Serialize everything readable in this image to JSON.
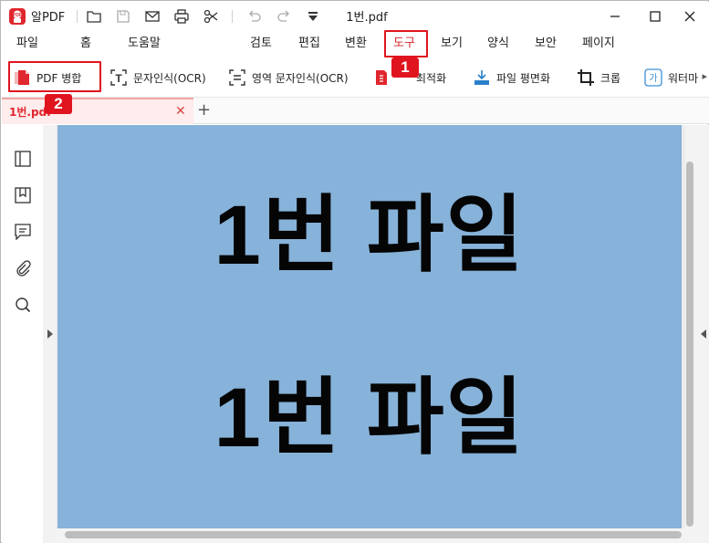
{
  "app": {
    "name": "알PDF",
    "document_title": "1번.pdf"
  },
  "titlebar": {
    "icons": [
      "folder-open-icon",
      "save-icon",
      "mail-icon",
      "print-icon",
      "scissors-icon",
      "undo-icon",
      "redo-icon",
      "quick-access-dropdown-icon"
    ],
    "window_controls": [
      "minimize-icon",
      "maximize-icon",
      "close-icon"
    ]
  },
  "menu": {
    "items": [
      "파일",
      "홈",
      "도움말",
      "검토",
      "편집",
      "변환",
      "도구",
      "보기",
      "양식",
      "보안",
      "페이지"
    ],
    "active": "도구"
  },
  "toolbar": {
    "tools": [
      {
        "label": "PDF 병합",
        "icon": "pdf-merge-icon"
      },
      {
        "label": "문자인식(OCR)",
        "icon": "text-ocr-icon"
      },
      {
        "label": "영역 문자인식(OCR)",
        "icon": "area-ocr-icon"
      },
      {
        "label": "최적화",
        "icon": "optimize-icon"
      },
      {
        "label": "파일 평면화",
        "icon": "flatten-icon"
      },
      {
        "label": "크롭",
        "icon": "crop-icon"
      },
      {
        "label": "워터마",
        "icon": "watermark-icon"
      }
    ]
  },
  "annotations": [
    {
      "number": "1",
      "target": "도구"
    },
    {
      "number": "2",
      "target": "PDF 병합"
    }
  ],
  "tabs": [
    {
      "label": "1번.pdf",
      "active": true
    }
  ],
  "sidebar": {
    "icons": [
      "page-thumbnail-icon",
      "bookmark-icon",
      "comment-icon",
      "attachment-icon",
      "search-icon"
    ]
  },
  "document": {
    "lines": [
      "1번 파일",
      "1번 파일"
    ],
    "page_color": "#87b2d9"
  },
  "colors": {
    "accent": "#e0141e",
    "active_tab_text": "#e0262e"
  }
}
